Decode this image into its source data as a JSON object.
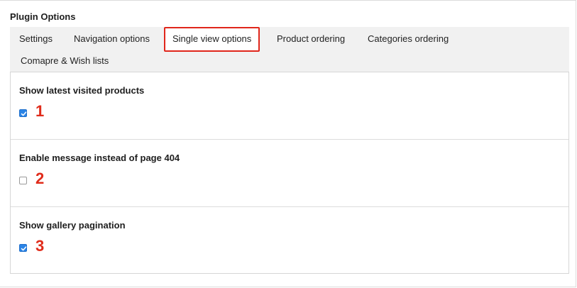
{
  "panel": {
    "title": "Plugin Options"
  },
  "tabs": [
    {
      "label": "Settings"
    },
    {
      "label": "Navigation options"
    },
    {
      "label": "Single view options",
      "active": true
    },
    {
      "label": "Product ordering"
    },
    {
      "label": "Categories ordering"
    },
    {
      "label": "Comapre & Wish lists"
    }
  ],
  "options": [
    {
      "label": "Show latest visited products",
      "checked": true,
      "marker": "1"
    },
    {
      "label": "Enable message instead of page 404",
      "checked": false,
      "marker": "2"
    },
    {
      "label": "Show gallery pagination",
      "checked": true,
      "marker": "3"
    }
  ],
  "colors": {
    "accent_checkbox": "#2b84e6",
    "highlight": "#e0261b"
  }
}
